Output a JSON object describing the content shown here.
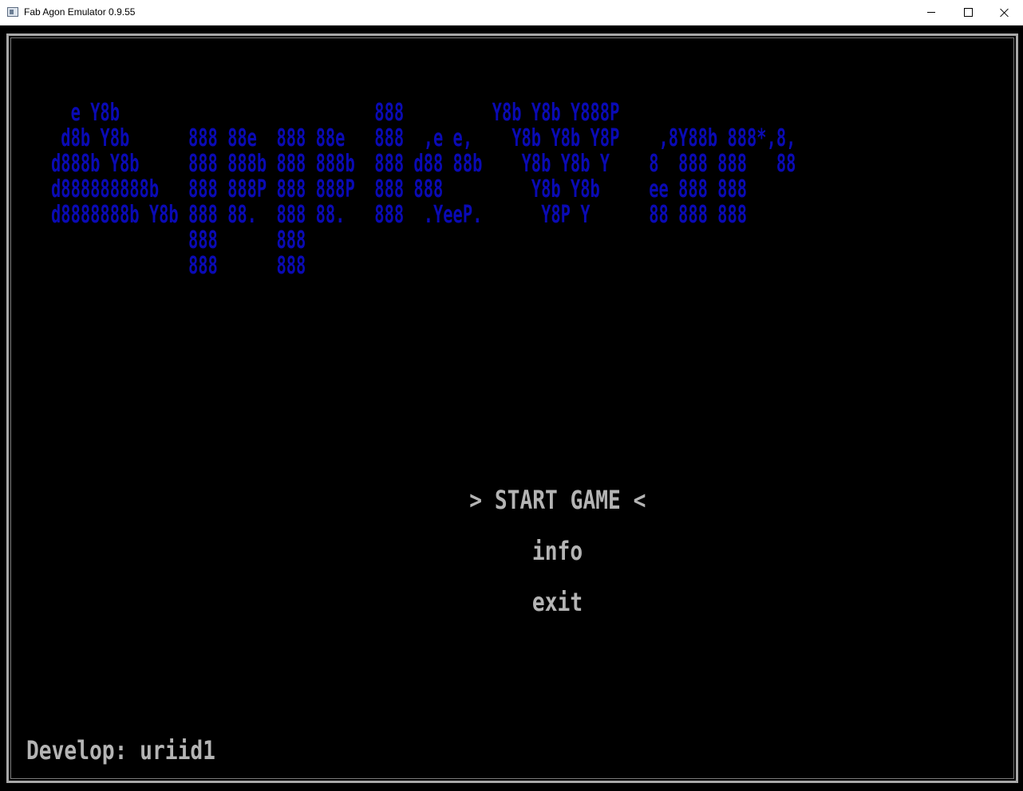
{
  "window": {
    "title": "Fab Agon Emulator 0.9.55",
    "controls": {
      "minimize": "minimize-icon",
      "maximize": "maximize-icon",
      "close": "close-icon"
    }
  },
  "screen": {
    "background": "#000000",
    "frame_color": "#a8a8a8",
    "logo_color": "#0a0ab4",
    "text_color": "#b4b4b4",
    "logo_ascii": "  e Y8b                          888         Y8b Y8b Y888P\n d8b Y8b      888 88e  888 88e   888  ,e e,    Y8b Y8b Y8P    ,8Y88b 888*,8,\nd888b Y8b     888 888b 888 888b  888 d88 88b    Y8b Y8b Y    8  888 888   88\nd888888888b   888 888P 888 888P  888 888         Y8b Y8b     ee 888 888\nd8888888b Y8b 888 88.  888 88.   888  .YeeP.      Y8P Y      88 888 888\n              888      888\n              888      888",
    "menu": {
      "start_game": "> START GAME <",
      "info": "info",
      "exit": "exit"
    },
    "credit": "Develop: uriid1"
  }
}
